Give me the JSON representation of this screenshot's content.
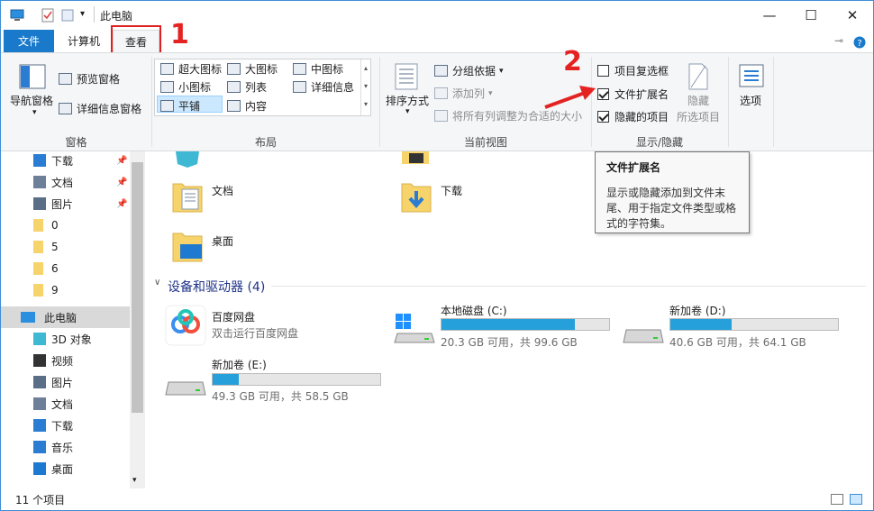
{
  "window": {
    "title": "此电脑",
    "minimize": "—",
    "maximize": "☐",
    "close": "✕"
  },
  "tabs": {
    "file": "文件",
    "computer": "计算机",
    "view": "查看"
  },
  "annotations": {
    "step1": "1",
    "step2": "2"
  },
  "ribbon": {
    "pane": {
      "nav_pane": "导航窗格",
      "preview": "预览窗格",
      "details": "详细信息窗格",
      "group": "窗格"
    },
    "layout": {
      "xl_icons": "超大图标",
      "l_icons": "大图标",
      "m_icons": "中图标",
      "s_icons": "小图标",
      "list": "列表",
      "details": "详细信息",
      "tiles": "平铺",
      "content": "内容",
      "group": "布局"
    },
    "current_view": {
      "sort": "排序方式",
      "group_by": "分组依据",
      "add_column": "添加列",
      "fit_columns": "将所有列调整为合适的大小",
      "group": "当前视图"
    },
    "show_hide": {
      "item_checkboxes": "项目复选框",
      "file_ext": "文件扩展名",
      "hidden_items": "隐藏的项目",
      "hide": "隐藏",
      "hide_selected": "所选项目",
      "group": "显示/隐藏"
    },
    "options": "选项"
  },
  "tooltip": {
    "title": "文件扩展名",
    "body": "显示或隐藏添加到文件末尾、用于指定文件类型或格式的字符集。"
  },
  "nav": {
    "items": [
      "下载",
      "文档",
      "图片",
      "0",
      "5",
      "6",
      "9",
      "此电脑",
      "3D 对象",
      "视频",
      "图片",
      "文档",
      "下载",
      "音乐",
      "桌面"
    ]
  },
  "content": {
    "folders": [
      "文档",
      "下载",
      "桌面"
    ],
    "section": "设备和驱动器 (4)",
    "drives": [
      {
        "name": "百度网盘",
        "sub": "双击运行百度网盘"
      },
      {
        "name": "本地磁盘 (C:)",
        "sub": "20.3 GB 可用，共 99.6 GB",
        "used": 0.796
      },
      {
        "name": "新加卷 (D:)",
        "sub": "40.6 GB 可用，共 64.1 GB",
        "used": 0.367
      },
      {
        "name": "新加卷 (E:)",
        "sub": "49.3 GB 可用，共 58.5 GB",
        "used": 0.157
      }
    ]
  },
  "status": {
    "count": "11 个项目"
  },
  "colors": {
    "accent": "#1979ca",
    "bar": "#26a0da",
    "annotation": "#e42222",
    "folder": "#f7d36b"
  }
}
